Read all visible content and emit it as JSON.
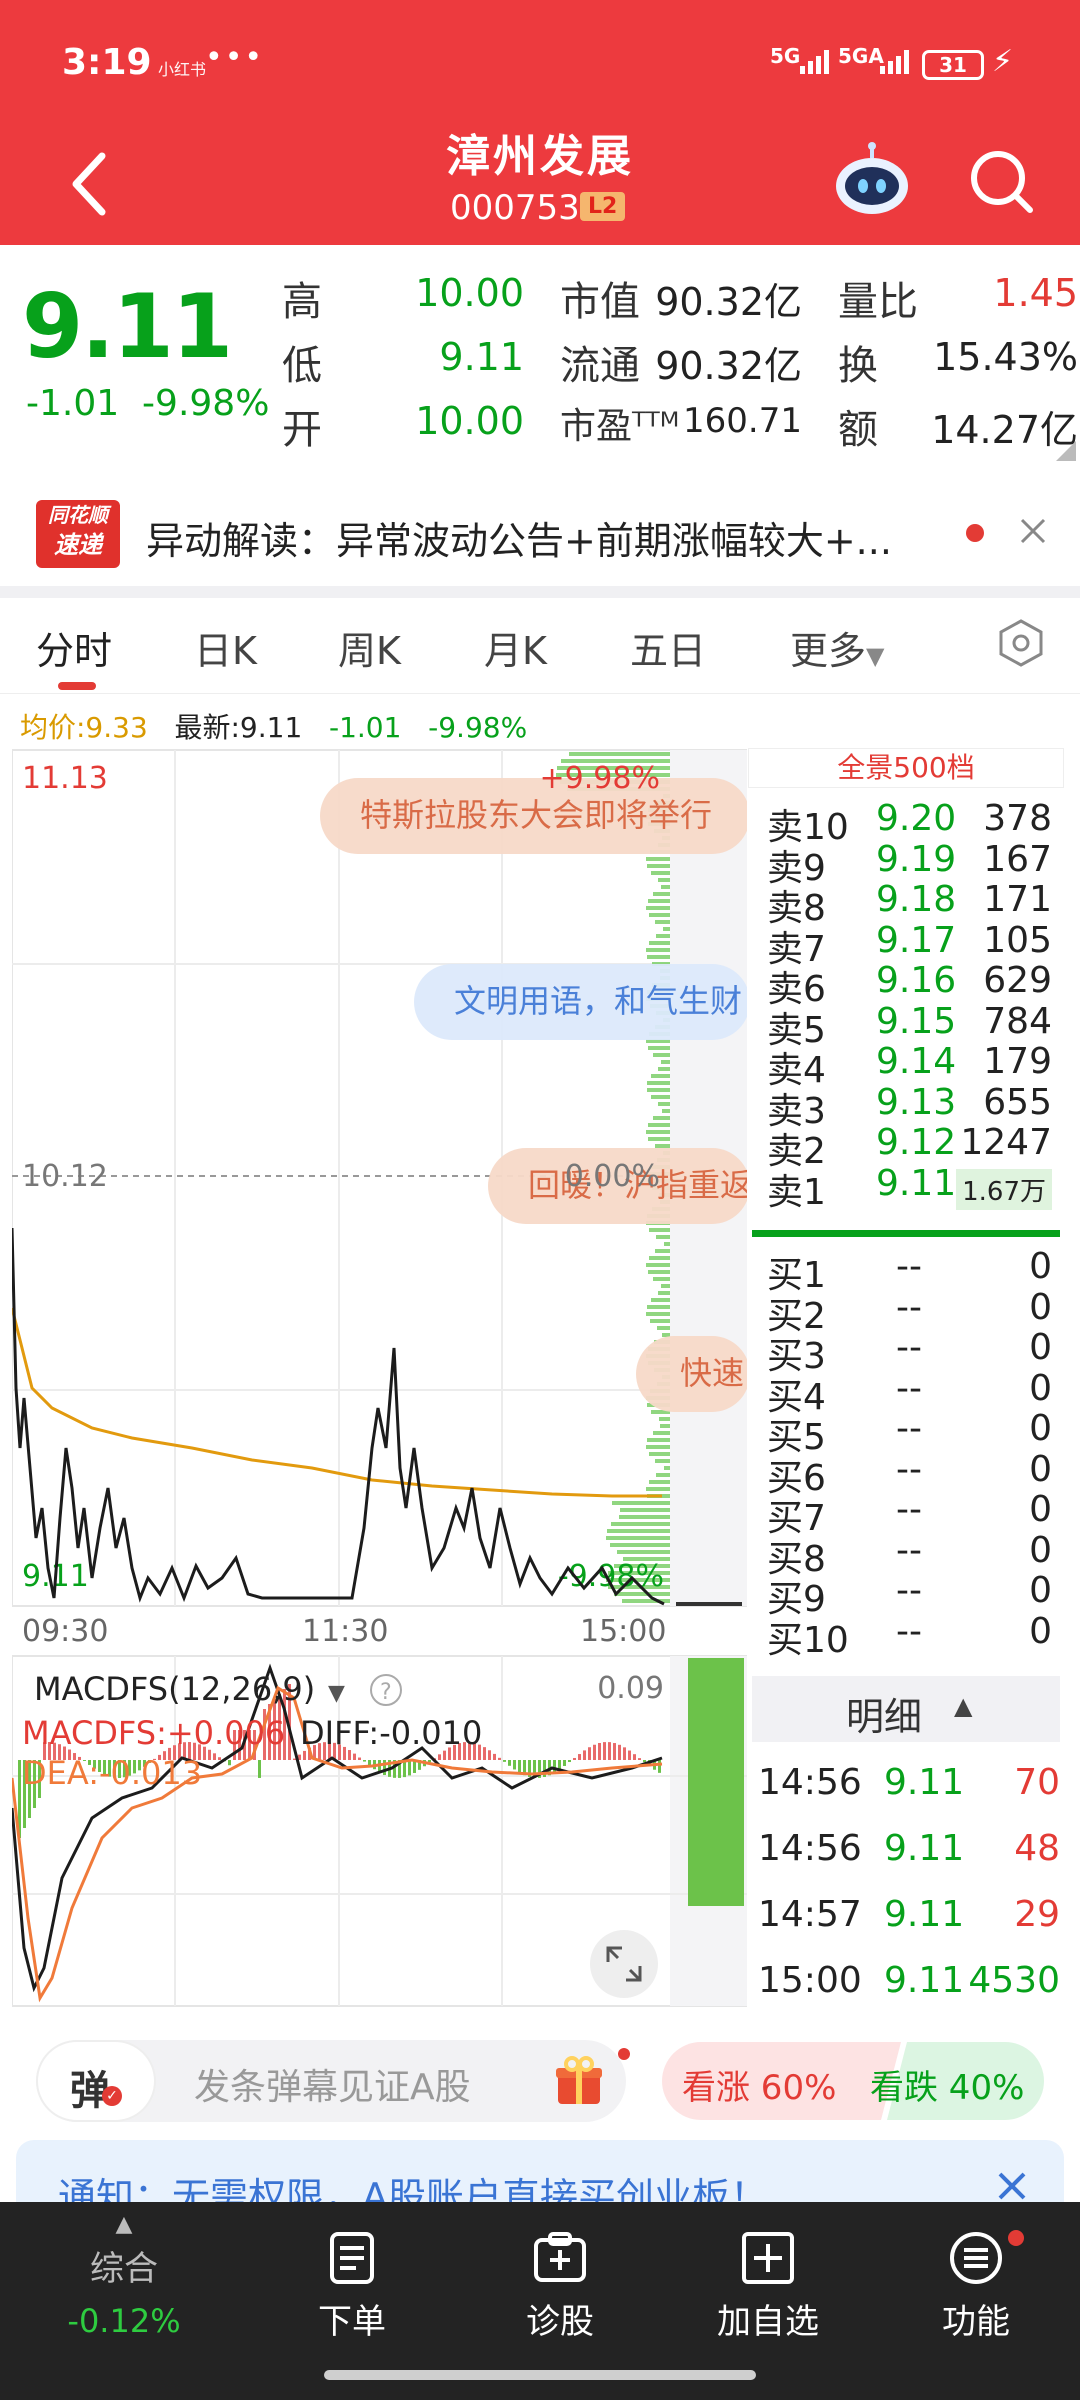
{
  "status": {
    "time": "3:19",
    "carrier": "小红书",
    "net1": "5G",
    "net2": "5GA",
    "battery": "31"
  },
  "header": {
    "title": "漳州发展",
    "code": "000753",
    "badge": "L2"
  },
  "quote": {
    "price": "9.11",
    "change": "-1.01",
    "pct": "-9.98%",
    "high_label": "高",
    "high": "10.00",
    "low_label": "低",
    "low": "9.11",
    "open_label": "开",
    "open": "10.00",
    "mcap_label": "市值",
    "mcap": "90.32亿",
    "float_label": "流通",
    "float": "90.32亿",
    "pe_label": "市盈ᵀᵀᴹ",
    "pe": "160.71",
    "vr_label": "量比",
    "vr": "1.45",
    "turn_label": "换",
    "turn": "15.43%",
    "amt_label": "额",
    "amt": "14.27亿"
  },
  "alert": {
    "logo_top": "同花顺",
    "logo_bottom": "速递",
    "text": "异动解读：异常波动公告+前期涨幅较大+..."
  },
  "tabs": [
    "分时",
    "日K",
    "周K",
    "月K",
    "五日",
    "更多"
  ],
  "legend": {
    "avg": "均价:9.33",
    "latest": "最新:9.11",
    "chg": "-1.01",
    "pct": "-9.98%"
  },
  "chart": {
    "ymax": "11.13",
    "ymid": "10.12",
    "ymin": "9.11",
    "pct_top": "+9.98%",
    "pct_mid": "0.00%",
    "pct_bot": "-9.98%",
    "times": [
      "09:30",
      "11:30",
      "15:00"
    ],
    "bubbles": [
      "特斯拉股东大会即将举行",
      "文明用语，和气生财",
      "回暖！沪指重返",
      "快速"
    ],
    "macd_title": "MACDFS(12,26,9)",
    "macd_val": "MACDFS:+0.006",
    "diff": "DIFF:-0.010",
    "dea": "DEA:-0.013",
    "macd_top": "0.09"
  },
  "orderbook": {
    "title": "全景500档",
    "asks": [
      {
        "l": "卖10",
        "p": "9.20",
        "v": "378"
      },
      {
        "l": "卖9",
        "p": "9.19",
        "v": "167"
      },
      {
        "l": "卖8",
        "p": "9.18",
        "v": "171"
      },
      {
        "l": "卖7",
        "p": "9.17",
        "v": "105"
      },
      {
        "l": "卖6",
        "p": "9.16",
        "v": "629"
      },
      {
        "l": "卖5",
        "p": "9.15",
        "v": "784"
      },
      {
        "l": "卖4",
        "p": "9.14",
        "v": "179"
      },
      {
        "l": "卖3",
        "p": "9.13",
        "v": "655"
      },
      {
        "l": "卖2",
        "p": "9.12",
        "v": "1247"
      },
      {
        "l": "卖1",
        "p": "9.11",
        "v": "1.67万"
      }
    ],
    "bids": [
      {
        "l": "买1",
        "p": "--",
        "v": "0"
      },
      {
        "l": "买2",
        "p": "--",
        "v": "0"
      },
      {
        "l": "买3",
        "p": "--",
        "v": "0"
      },
      {
        "l": "买4",
        "p": "--",
        "v": "0"
      },
      {
        "l": "买5",
        "p": "--",
        "v": "0"
      },
      {
        "l": "买6",
        "p": "--",
        "v": "0"
      },
      {
        "l": "买7",
        "p": "--",
        "v": "0"
      },
      {
        "l": "买8",
        "p": "--",
        "v": "0"
      },
      {
        "l": "买9",
        "p": "--",
        "v": "0"
      },
      {
        "l": "买10",
        "p": "--",
        "v": "0"
      }
    ],
    "detail_title": "明细",
    "detail": [
      {
        "t": "14:56",
        "p": "9.11",
        "v": "70"
      },
      {
        "t": "14:56",
        "p": "9.11",
        "v": "48"
      },
      {
        "t": "14:57",
        "p": "9.11",
        "v": "29"
      },
      {
        "t": "15:00",
        "p": "9.11",
        "v": "4530"
      }
    ]
  },
  "danmu": {
    "label": "弹",
    "placeholder": "发条弹幕见证A股",
    "rise": "看涨 60%",
    "fall": "看跌 40%",
    "rise_pct": 60
  },
  "notice": {
    "text": "通知：无需权限，A股账户直接买创业板！"
  },
  "nav": [
    {
      "label": "综合",
      "sub": "-0.12%"
    },
    {
      "label": "下单"
    },
    {
      "label": "诊股"
    },
    {
      "label": "加自选"
    },
    {
      "label": "功能"
    }
  ]
}
